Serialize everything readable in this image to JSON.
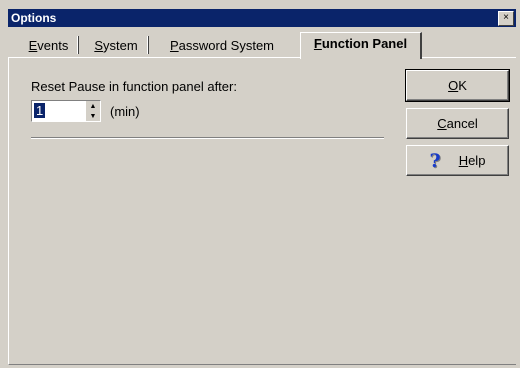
{
  "window": {
    "title": "Options",
    "close_glyph": "×"
  },
  "tabs": [
    {
      "label": "Events",
      "accel": "E",
      "rest": "vents",
      "active": false
    },
    {
      "label": "System",
      "accel": "S",
      "rest": "ystem",
      "active": false
    },
    {
      "label": "Password System",
      "accel": "P",
      "rest": "assword System",
      "active": false
    },
    {
      "label": "Function Panel",
      "accel": "F",
      "rest": "unction Panel",
      "active": true
    }
  ],
  "panel": {
    "reset_label": "Reset Pause in function panel after:",
    "spin_value": "1",
    "unit_label": "(min)"
  },
  "buttons": {
    "ok": {
      "accel": "O",
      "rest": "K"
    },
    "cancel": {
      "accel": "C",
      "rest": "ancel"
    },
    "help": {
      "icon": "?",
      "accel": "H",
      "rest": "elp"
    }
  },
  "colors": {
    "titlebar": "#0a246a",
    "face": "#d4d0c8",
    "help_icon": "#1a3cc8"
  }
}
